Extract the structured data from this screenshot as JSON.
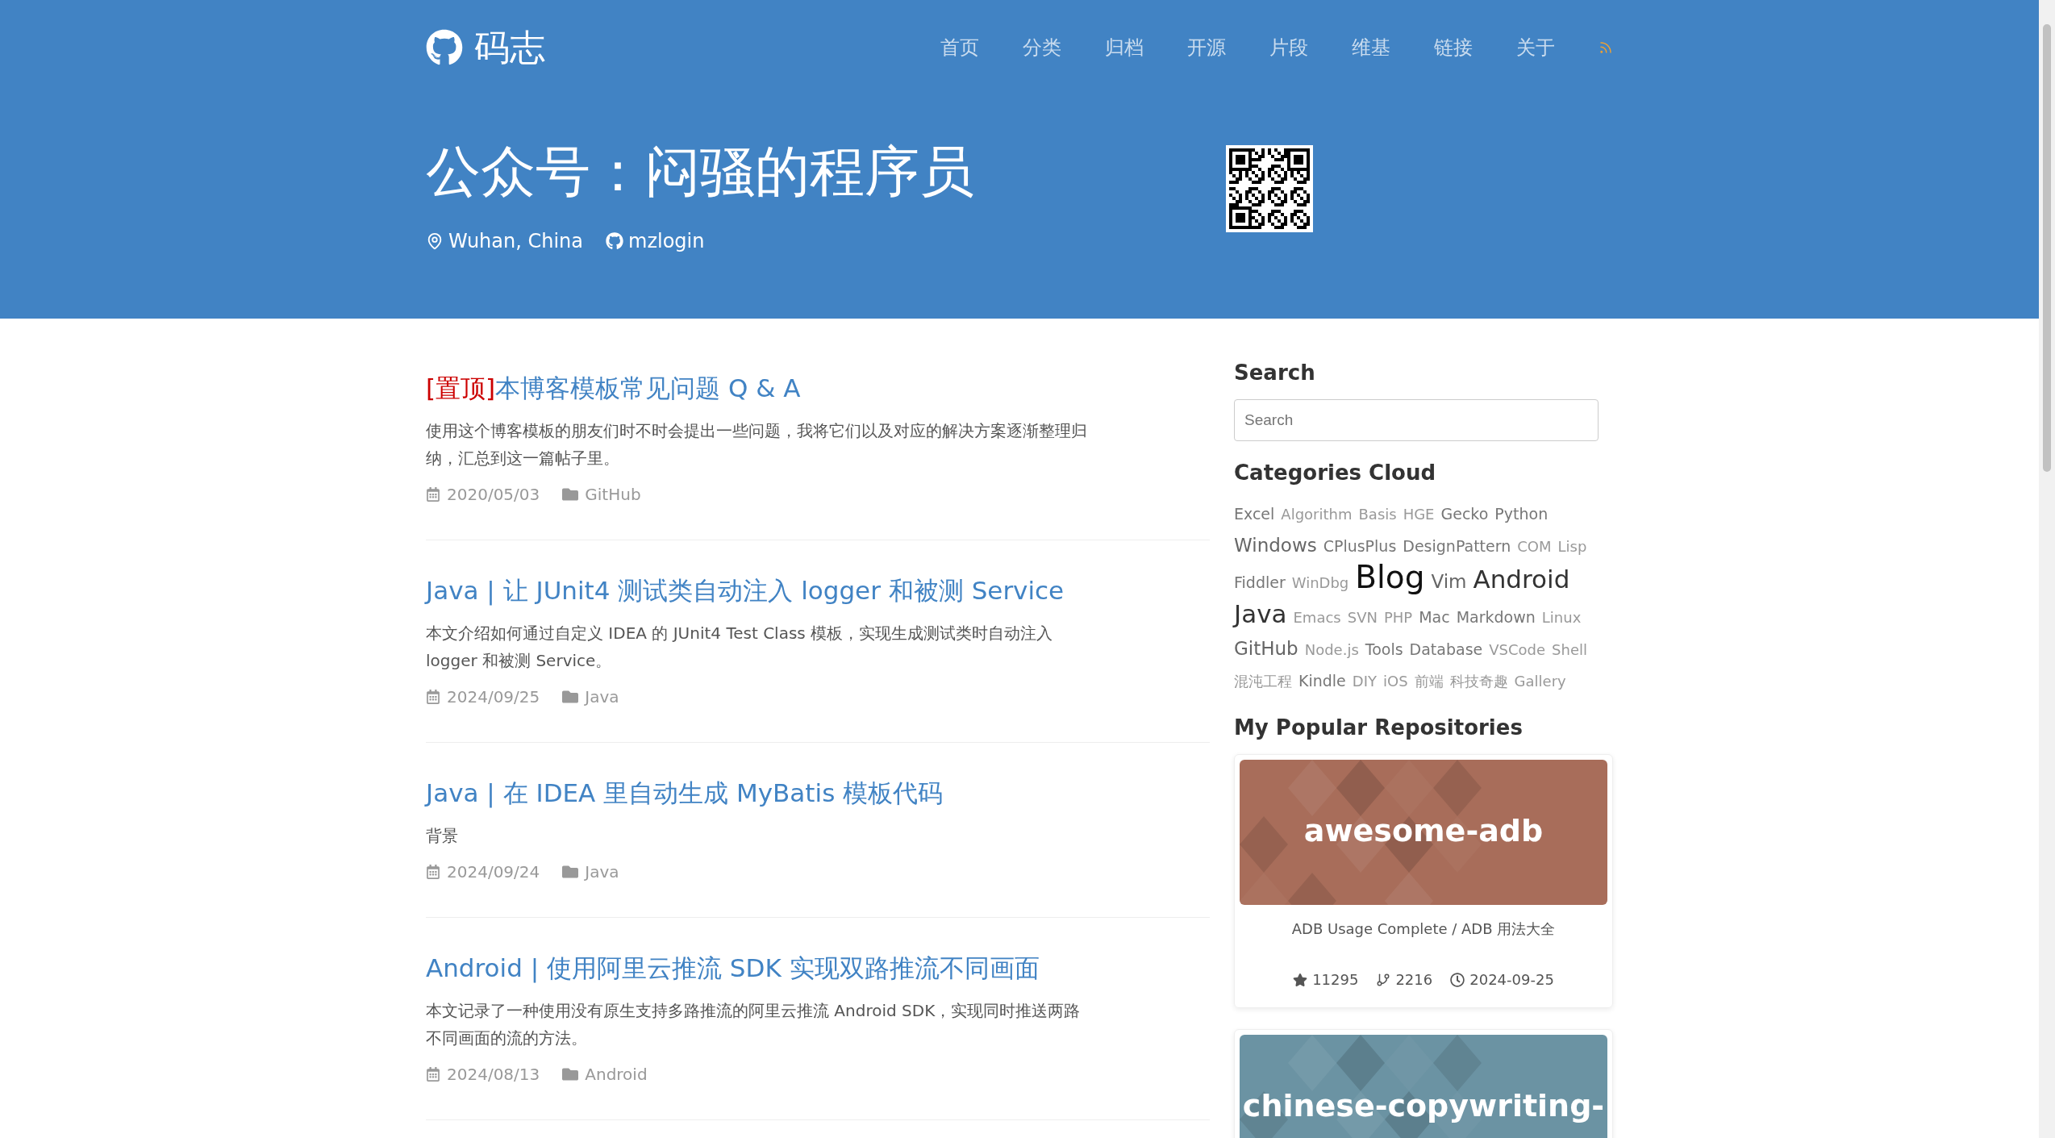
{
  "header": {
    "logo": "码志",
    "nav": [
      {
        "label": "首页"
      },
      {
        "label": "分类"
      },
      {
        "label": "归档"
      },
      {
        "label": "开源"
      },
      {
        "label": "片段"
      },
      {
        "label": "维基"
      },
      {
        "label": "链接"
      },
      {
        "label": "关于"
      }
    ],
    "title": "公众号：闷骚的程序员",
    "location": "Wuhan, China",
    "github": "mzlogin"
  },
  "posts": [
    {
      "pin": "[置顶]",
      "title": "本博客模板常见问题 Q & A",
      "excerpt": "使用这个博客模板的朋友们时不时会提出一些问题，我将它们以及对应的解决方案逐渐整理归纳，汇总到这一篇帖子里。",
      "date": "2020/05/03",
      "category": "GitHub"
    },
    {
      "title": "Java | 让 JUnit4 测试类自动注入 logger 和被测 Service",
      "excerpt": "本文介绍如何通过自定义 IDEA 的 JUnit4 Test Class 模板，实现生成测试类时自动注入 logger 和被测 Service。",
      "date": "2024/09/25",
      "category": "Java"
    },
    {
      "title": "Java | 在 IDEA 里自动生成 MyBatis 模板代码",
      "excerpt": "背景",
      "date": "2024/09/24",
      "category": "Java"
    },
    {
      "title": "Android | 使用阿里云推流 SDK 实现双路推流不同画面",
      "excerpt": "本文记录了一种使用没有原生支持多路推流的阿里云推流 Android SDK，实现同时推送两路不同画面的流的方法。",
      "date": "2024/08/13",
      "category": "Android"
    }
  ],
  "sidebar": {
    "search_title": "Search",
    "search": {
      "placeholder": "Search"
    },
    "cloud_title": "Categories Cloud",
    "tags": [
      {
        "label": "Excel",
        "kind": "medium"
      },
      {
        "label": "Algorithm",
        "kind": "small"
      },
      {
        "label": "Basis",
        "kind": "small"
      },
      {
        "label": "HGE",
        "kind": "small"
      },
      {
        "label": "Gecko",
        "kind": "medium"
      },
      {
        "label": "Python",
        "kind": "medium"
      },
      {
        "label": "Windows",
        "kind": "large"
      },
      {
        "label": "CPlusPlus",
        "kind": "medium"
      },
      {
        "label": "DesignPattern",
        "kind": "medium"
      },
      {
        "label": "COM",
        "kind": "small"
      },
      {
        "label": "Lisp",
        "kind": "small"
      },
      {
        "label": "Fiddler",
        "kind": "medium"
      },
      {
        "label": "WinDbg",
        "kind": "small"
      },
      {
        "label": "Blog",
        "kind": "giant"
      },
      {
        "label": "Vim",
        "kind": "large"
      },
      {
        "label": "Android",
        "kind": "huge"
      },
      {
        "label": "Java",
        "kind": "huge"
      },
      {
        "label": "Emacs",
        "kind": "small"
      },
      {
        "label": "SVN",
        "kind": "small"
      },
      {
        "label": "PHP",
        "kind": "small"
      },
      {
        "label": "Mac",
        "kind": "medium"
      },
      {
        "label": "Markdown",
        "kind": "medium"
      },
      {
        "label": "Linux",
        "kind": "small"
      },
      {
        "label": "GitHub",
        "kind": "large"
      },
      {
        "label": "Node.js",
        "kind": "small"
      },
      {
        "label": "Tools",
        "kind": "medium"
      },
      {
        "label": "Database",
        "kind": "medium"
      },
      {
        "label": "VSCode",
        "kind": "small"
      },
      {
        "label": "Shell",
        "kind": "small"
      },
      {
        "label": "混沌工程",
        "kind": "small"
      },
      {
        "label": "Kindle",
        "kind": "medium"
      },
      {
        "label": "DIY",
        "kind": "small"
      },
      {
        "label": "iOS",
        "kind": "small"
      },
      {
        "label": "前端",
        "kind": "small"
      },
      {
        "label": "科技奇趣",
        "kind": "small"
      },
      {
        "label": "Gallery",
        "kind": "small"
      }
    ],
    "repos_title": "My Popular Repositories",
    "repos": [
      {
        "name": "awesome-adb",
        "color": "#a86d5a",
        "description": "ADB Usage Complete / ADB 用法大全",
        "stars": "11295",
        "forks": "2216",
        "updated": "2024-09-25"
      },
      {
        "name": "chinese-copywriting-",
        "color": "#6b93a3"
      }
    ]
  }
}
